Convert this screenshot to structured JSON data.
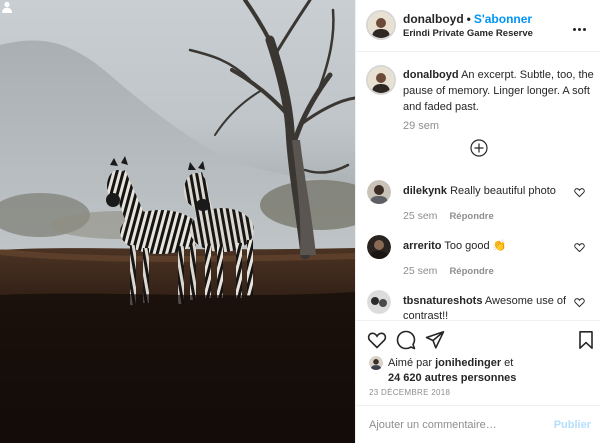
{
  "post": {
    "image_alt": "Two zebras standing beside a bare tree in a savanna"
  },
  "header": {
    "username": "donalboyd",
    "separator": "•",
    "follow_label": "S'abonner",
    "location": "Erindi Private Game Reserve",
    "more_icon": "more-horizontal-icon"
  },
  "caption": {
    "username": "donalboyd",
    "text": "An excerpt. Subtle, too, the pause of memory. Linger longer. A soft and faded past.",
    "time": "29 sem"
  },
  "load_more_icon": "plus-circle-icon",
  "comments": [
    {
      "username": "dilekynk",
      "text": "Really beautiful photo",
      "time": "25 sem",
      "reply_label": "Répondre"
    },
    {
      "username": "arrerito",
      "text": "Too good 👏",
      "time": "25 sem",
      "reply_label": "Répondre"
    },
    {
      "username": "tbsnatureshots",
      "text": "Awesome use of contrast!!",
      "time": "",
      "reply_label": ""
    }
  ],
  "actions": {
    "like_icon": "heart-icon",
    "comment_icon": "comment-icon",
    "share_icon": "share-icon",
    "save_icon": "bookmark-icon"
  },
  "likes": {
    "prefix": "Aimé par",
    "user": "jonihedinger",
    "and": "et",
    "others": "24 620 autres personnes"
  },
  "date": "23 DÉCEMBRE 2018",
  "add_comment": {
    "placeholder": "Ajouter un commentaire…",
    "publish_label": "Publier"
  },
  "colors": {
    "link_blue": "#0095f6",
    "publish_disabled": "#b2dffc",
    "muted": "#8e8e8e",
    "text": "#262626"
  }
}
